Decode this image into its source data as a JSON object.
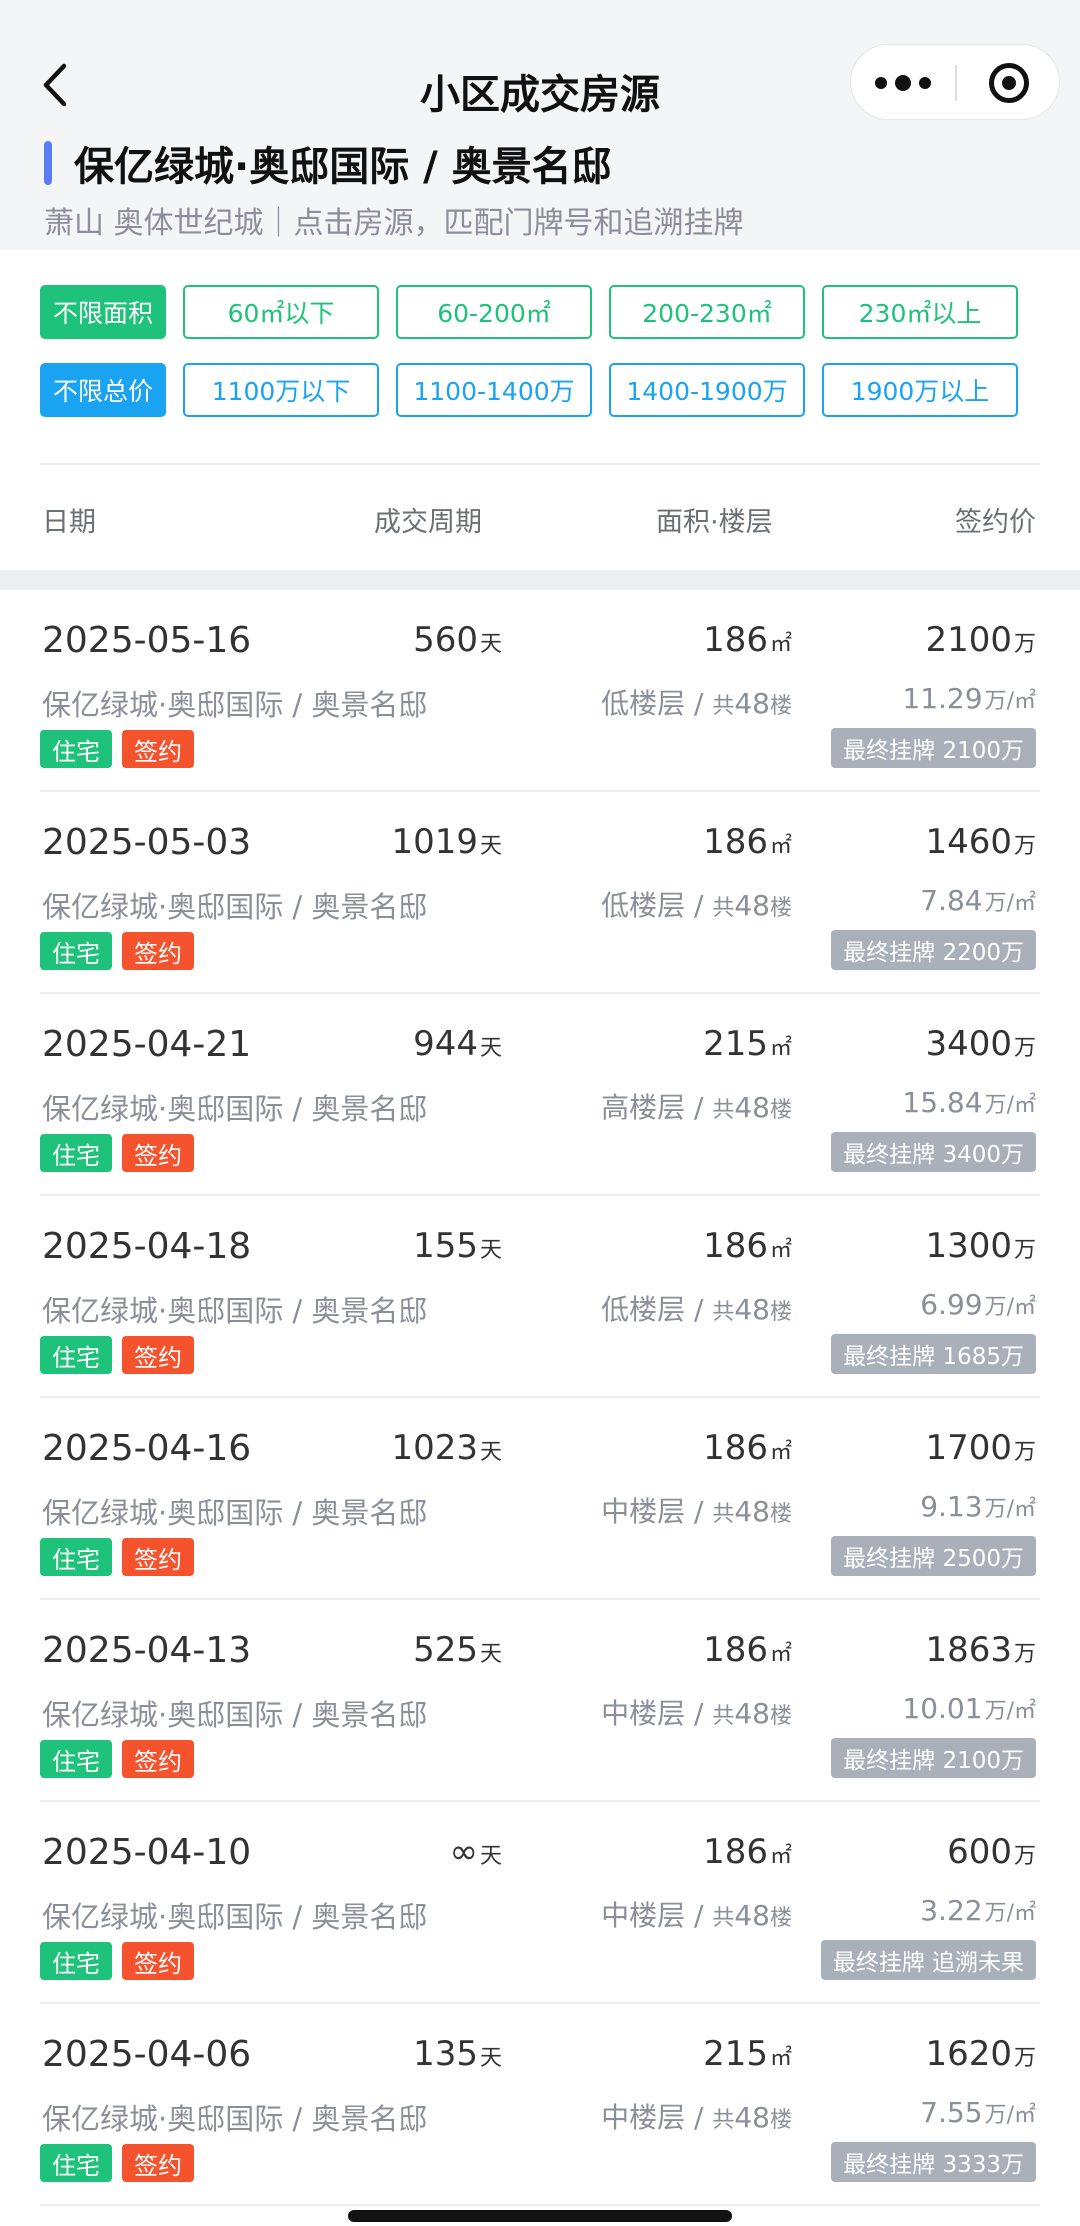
{
  "nav": {
    "title": "小区成交房源"
  },
  "header": {
    "community_name": "保亿绿城·奥邸国际 / 奥景名邸",
    "subtitle": "萧山 奥体世纪城｜点击房源，匹配门牌号和追溯挂牌"
  },
  "filters": {
    "area": {
      "all_label": "不限面积",
      "options": [
        "60㎡以下",
        "60-200㎡",
        "200-230㎡",
        "230㎡以上"
      ]
    },
    "price": {
      "all_label": "不限总价",
      "options": [
        "1100万以下",
        "1100-1400万",
        "1400-1900万",
        "1900万以上"
      ]
    }
  },
  "columns": [
    "日期",
    "成交周期",
    "面积·楼层",
    "签约价"
  ],
  "units": {
    "day": "天",
    "sqm": "㎡",
    "wan": "万",
    "wan_per_sqm": "万/㎡",
    "floor_prefix": "共",
    "floor_suffix": "楼"
  },
  "listings": [
    {
      "date": "2025-05-16",
      "cycle": "560",
      "area": "186",
      "price": "2100",
      "community": "保亿绿城·奥邸国际 / 奥景名邸",
      "floor_level": "低楼层",
      "total_floors": "48",
      "unit_price": "11.29",
      "tag_type": "住宅",
      "tag_status": "签约",
      "last_listing": "最终挂牌 2100万"
    },
    {
      "date": "2025-05-03",
      "cycle": "1019",
      "area": "186",
      "price": "1460",
      "community": "保亿绿城·奥邸国际 / 奥景名邸",
      "floor_level": "低楼层",
      "total_floors": "48",
      "unit_price": "7.84",
      "tag_type": "住宅",
      "tag_status": "签约",
      "last_listing": "最终挂牌 2200万"
    },
    {
      "date": "2025-04-21",
      "cycle": "944",
      "area": "215",
      "price": "3400",
      "community": "保亿绿城·奥邸国际 / 奥景名邸",
      "floor_level": "高楼层",
      "total_floors": "48",
      "unit_price": "15.84",
      "tag_type": "住宅",
      "tag_status": "签约",
      "last_listing": "最终挂牌 3400万"
    },
    {
      "date": "2025-04-18",
      "cycle": "155",
      "area": "186",
      "price": "1300",
      "community": "保亿绿城·奥邸国际 / 奥景名邸",
      "floor_level": "低楼层",
      "total_floors": "48",
      "unit_price": "6.99",
      "tag_type": "住宅",
      "tag_status": "签约",
      "last_listing": "最终挂牌 1685万"
    },
    {
      "date": "2025-04-16",
      "cycle": "1023",
      "area": "186",
      "price": "1700",
      "community": "保亿绿城·奥邸国际 / 奥景名邸",
      "floor_level": "中楼层",
      "total_floors": "48",
      "unit_price": "9.13",
      "tag_type": "住宅",
      "tag_status": "签约",
      "last_listing": "最终挂牌 2500万"
    },
    {
      "date": "2025-04-13",
      "cycle": "525",
      "area": "186",
      "price": "1863",
      "community": "保亿绿城·奥邸国际 / 奥景名邸",
      "floor_level": "中楼层",
      "total_floors": "48",
      "unit_price": "10.01",
      "tag_type": "住宅",
      "tag_status": "签约",
      "last_listing": "最终挂牌 2100万"
    },
    {
      "date": "2025-04-10",
      "cycle": "∞",
      "area": "186",
      "price": "600",
      "community": "保亿绿城·奥邸国际 / 奥景名邸",
      "floor_level": "中楼层",
      "total_floors": "48",
      "unit_price": "3.22",
      "tag_type": "住宅",
      "tag_status": "签约",
      "last_listing": "最终挂牌 追溯未果"
    },
    {
      "date": "2025-04-06",
      "cycle": "135",
      "area": "215",
      "price": "1620",
      "community": "保亿绿城·奥邸国际 / 奥景名邸",
      "floor_level": "中楼层",
      "total_floors": "48",
      "unit_price": "7.55",
      "tag_type": "住宅",
      "tag_status": "签约",
      "last_listing": "最终挂牌 3333万"
    }
  ]
}
